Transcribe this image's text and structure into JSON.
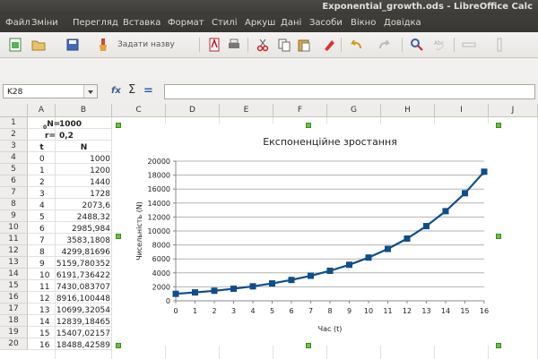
{
  "window": {
    "title": "Exponential_growth.ods - LibreOffice Calc"
  },
  "menu": [
    "Файл",
    "Зміни",
    "Перегляд",
    "Вставка",
    "Формат",
    "Стилі",
    "Аркуш",
    "Дані",
    "Засоби",
    "Вікно",
    "Довідка"
  ],
  "toolbar": {
    "style_placeholder": "Задати назву"
  },
  "formula_bar": {
    "name_box": "K28",
    "content": ""
  },
  "sheet": {
    "columns": [
      "A",
      "B",
      "C",
      "D",
      "E",
      "F",
      "G",
      "H",
      "I",
      "J"
    ],
    "rows": [
      "1",
      "2",
      "3",
      "4",
      "5",
      "6",
      "7",
      "8",
      "9",
      "10",
      "11",
      "12",
      "13",
      "14",
      "15",
      "16",
      "17",
      "18",
      "19",
      "20"
    ],
    "a1": "N",
    "a1_sub": "0",
    "b1": "1000",
    "a2": "r",
    "b2": "0,2",
    "header_t": "t",
    "header_n": "N",
    "t": [
      "0",
      "1",
      "2",
      "3",
      "4",
      "5",
      "6",
      "7",
      "8",
      "9",
      "10",
      "11",
      "12",
      "13",
      "14",
      "15",
      "16"
    ],
    "n": [
      "1000",
      "1200",
      "1440",
      "1728",
      "2073,6",
      "2488,32",
      "2985,984",
      "3583,1808",
      "4299,81696",
      "5159,780352",
      "6191,736422",
      "7430,083707",
      "8916,100448",
      "10699,32054",
      "12839,18465",
      "15407,02157",
      "18488,42589"
    ]
  },
  "chart_data": {
    "type": "line",
    "title": "Експоненційне зростання",
    "xlabel": "Час (t)",
    "ylabel": "Чисельність (N)",
    "x": [
      0,
      1,
      2,
      3,
      4,
      5,
      6,
      7,
      8,
      9,
      10,
      11,
      12,
      13,
      14,
      15,
      16
    ],
    "series": [
      {
        "values": [
          1000,
          1200,
          1440,
          1728,
          2073.6,
          2488.32,
          2985.984,
          3583.1808,
          4299.81696,
          5159.780352,
          6191.736422,
          7430.083707,
          8916.100448,
          10699.32054,
          12839.18465,
          15407.02157,
          18488.42589
        ]
      }
    ],
    "xlim": [
      0,
      16
    ],
    "ylim": [
      0,
      20000
    ],
    "yticks": [
      "0",
      "2000",
      "4000",
      "6000",
      "8000",
      "10000",
      "12000",
      "14000",
      "16000",
      "18000",
      "20000"
    ],
    "xticks": [
      "0",
      "1",
      "2",
      "3",
      "4",
      "5",
      "6",
      "7",
      "8",
      "9",
      "10",
      "11",
      "12",
      "13",
      "14",
      "15",
      "16"
    ],
    "grid": true,
    "legend": "none",
    "color": "#0e4e8a"
  }
}
